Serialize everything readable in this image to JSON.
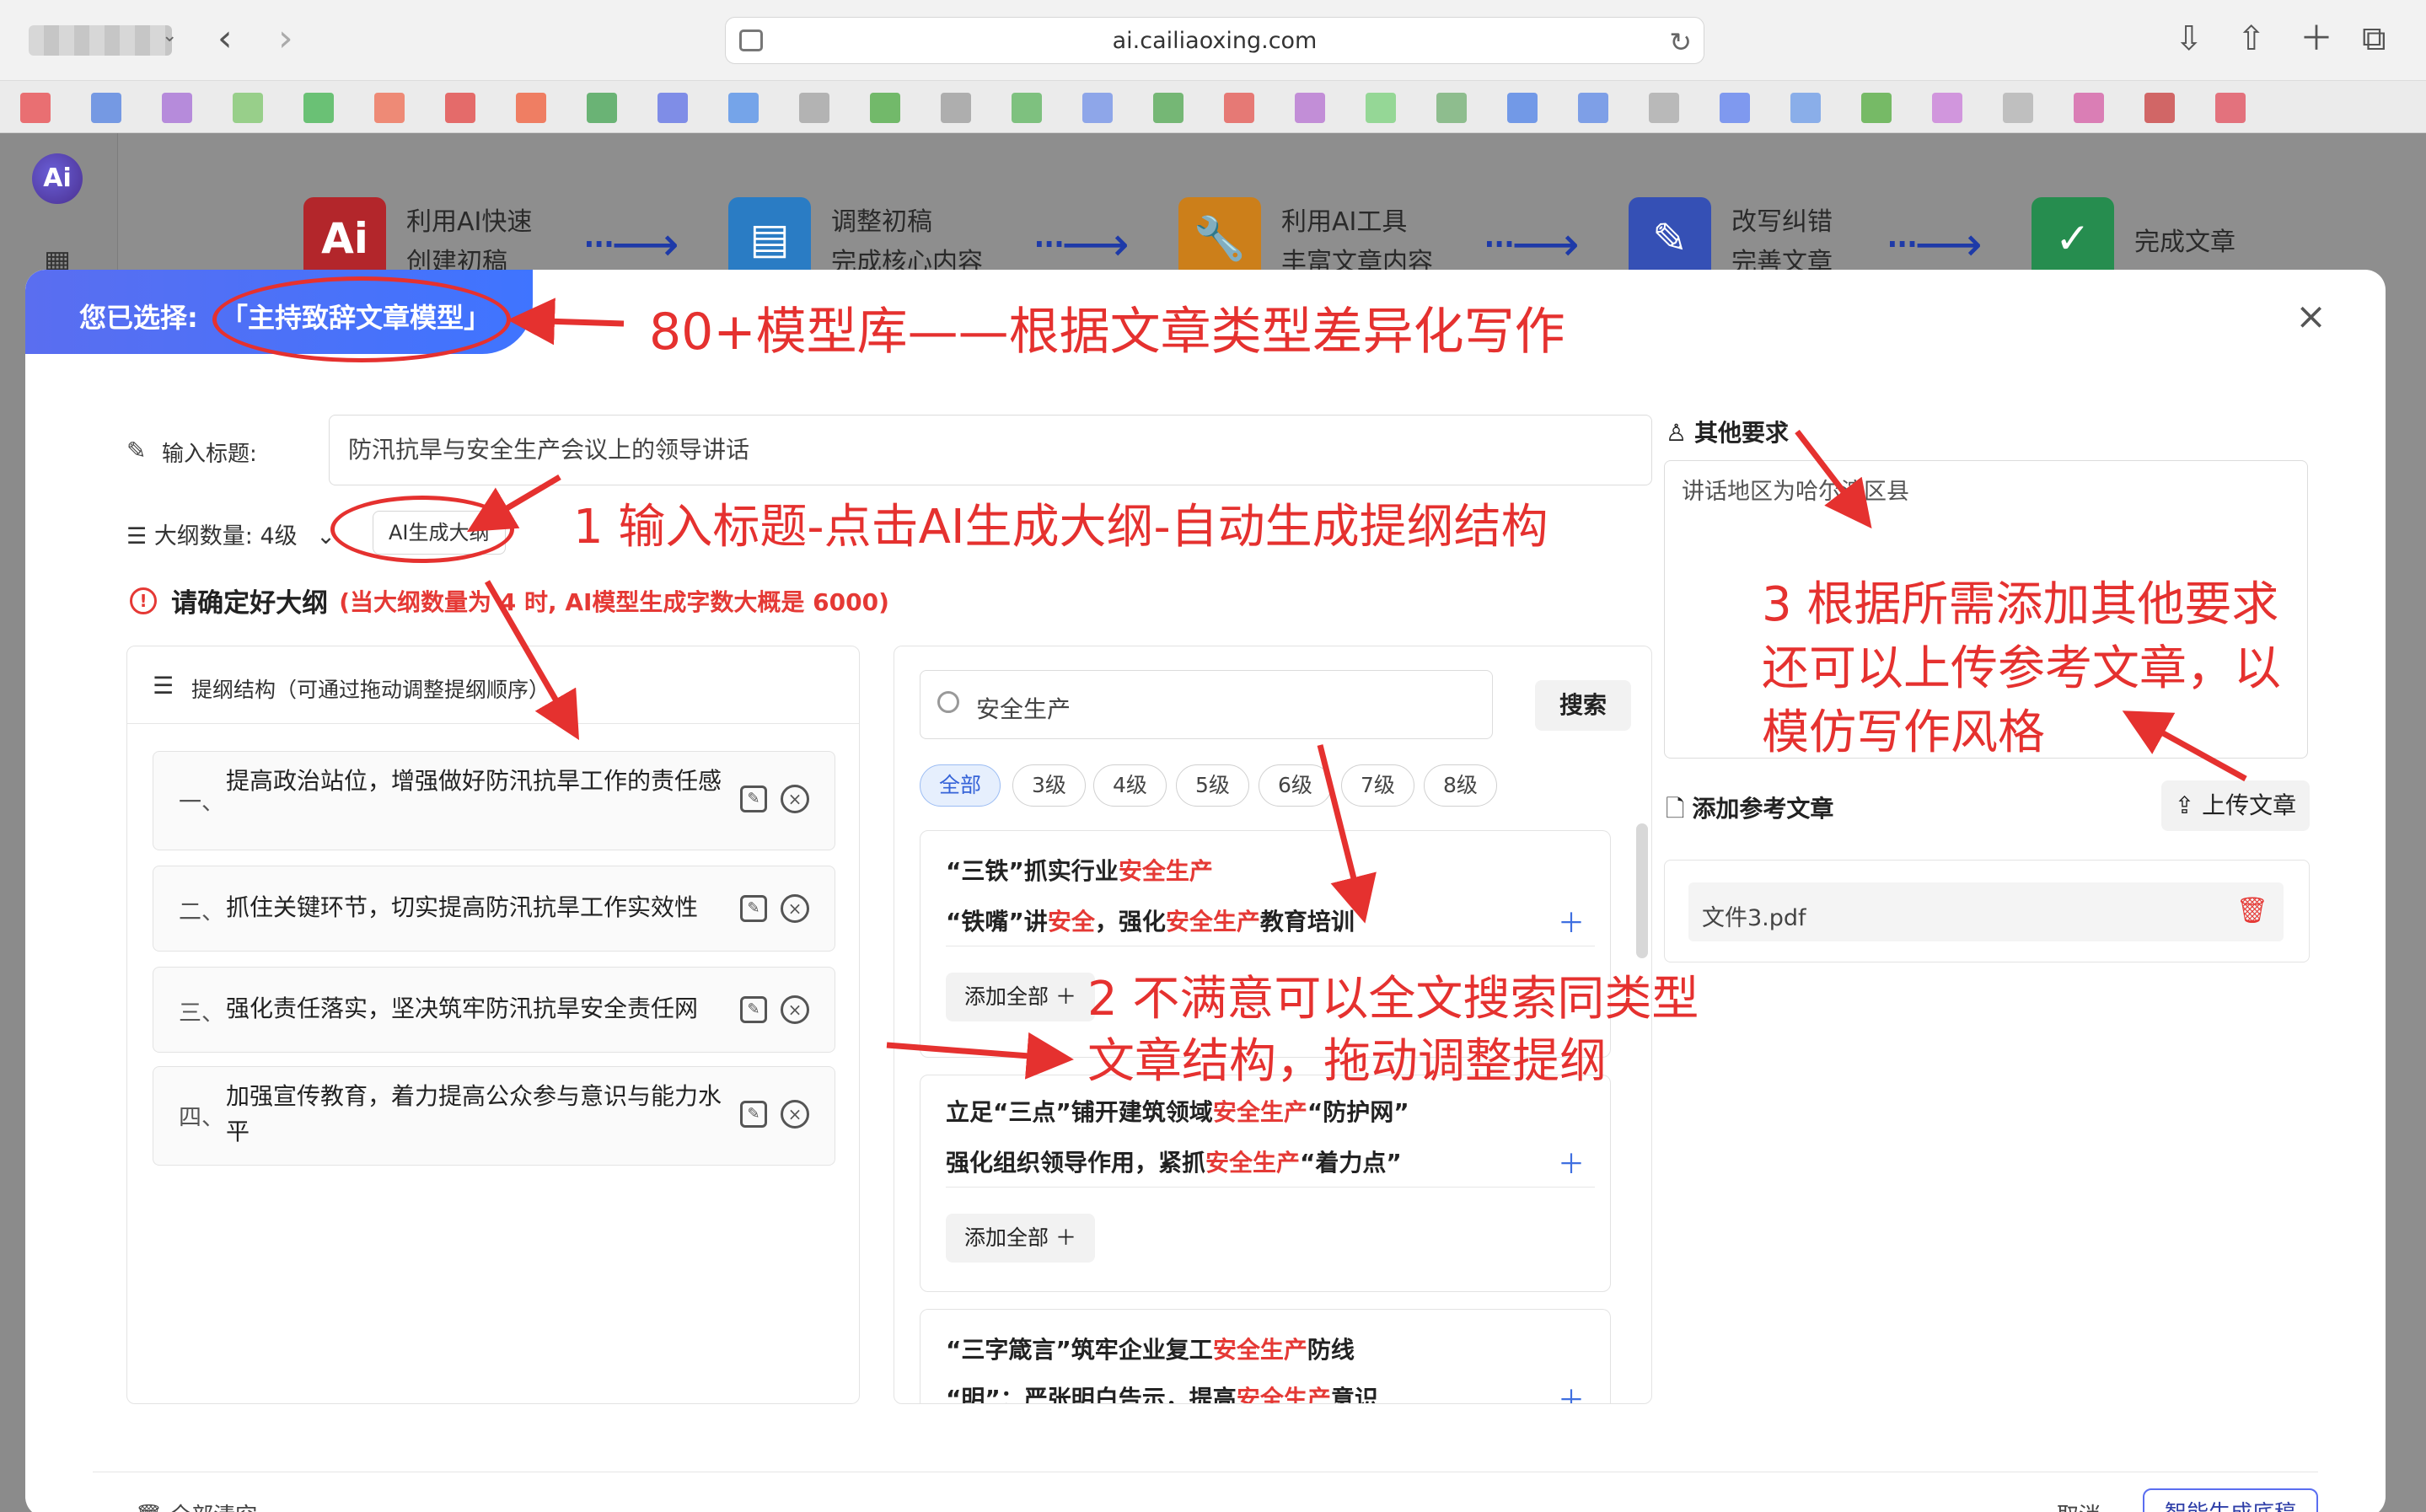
{
  "browser": {
    "url": "ai.cailiaoxing.com",
    "bookmark_colors": [
      "#e8454a",
      "#4e7de0",
      "#a46bd6",
      "#7cc66a",
      "#3fb34d",
      "#ef6a4f",
      "#e2403f",
      "#f05a36",
      "#3fa04d",
      "#5b6de6",
      "#4d8ce8",
      "#a0a0a0",
      "#4aa83f",
      "#9a9a9a",
      "#5ab35b",
      "#6f8fe8",
      "#4ea64d",
      "#e4534d",
      "#b46fd0",
      "#78d07a",
      "#6fae6f",
      "#4a7ee6",
      "#5a86e6",
      "#a8a8a8",
      "#5b7ef0",
      "#6a9ae8",
      "#4faa3a",
      "#c879d8",
      "#b0b0b0",
      "#d45aa3",
      "#c83a3a",
      "#e04a58"
    ]
  },
  "app": {
    "logo_text": "Ai",
    "steps": [
      {
        "icon": "Ai",
        "color": "#c1272d",
        "line1": "利用AI快速",
        "line2": "创建初稿"
      },
      {
        "icon": "▤",
        "color": "#2e88d6",
        "line1": "调整初稿",
        "line2": "完成核心内容"
      },
      {
        "icon": "🔧",
        "color": "#e08b1c",
        "line1": "利用AI工具",
        "line2": "丰富文章内容"
      },
      {
        "icon": "✎",
        "color": "#3b58c6",
        "line1": "改写纠错",
        "line2": "完善文章"
      },
      {
        "icon": "✓",
        "color": "#2a9d58",
        "line1": "完成文章",
        "line2": ""
      }
    ]
  },
  "modal": {
    "selected_label": "您已选择:",
    "selected_model": "「主持致辞文章模型」",
    "close": "×",
    "title_label": "输入标题:",
    "title_value": "防汛抗旱与安全生产会议上的领导讲话",
    "level_label": "大纲数量: 4级",
    "ai_button": "AI生成大纲",
    "confirm_head": "请确定好大纲",
    "confirm_note": "(当大纲数量为 4 时, AI模型生成字数大概是 6000)",
    "outline_header": "提纲结构（可通过拖动调整提纲顺序）",
    "outline": [
      {
        "num": "一、",
        "text": "提高政治站位，增强做好防汛抗旱工作的责任感"
      },
      {
        "num": "二、",
        "text": "抓住关键环节，切实提高防汛抗旱工作实效性"
      },
      {
        "num": "三、",
        "text": "强化责任落实，坚决筑牢防汛抗旱安全责任网"
      },
      {
        "num": "四、",
        "text": "加强宣传教育，着力提高公众参与意识与能力水平"
      }
    ],
    "search_value": "安全生产",
    "search_button": "搜索",
    "chips": [
      "全部",
      "3级",
      "4级",
      "5级",
      "6级",
      "7级",
      "8级"
    ],
    "results": [
      {
        "l1_pre": "“三铁”抓实行业",
        "l1_hl": "安全生产",
        "l1_post": "",
        "l2_pre": "“铁嘴”讲",
        "l2_hl": "安全",
        "l2_mid": "，强化",
        "l2_hl2": "安全生产",
        "l2_post": "教育培训",
        "add_all": "添加全部  ＋"
      },
      {
        "l1_pre": "立足“三点”铺开建筑领域",
        "l1_hl": "安全生产",
        "l1_post": "“防护网”",
        "l2_pre": "强化组织领导作用，紧抓",
        "l2_hl": "安全生产",
        "l2_mid": "“着力点”",
        "l2_hl2": "",
        "l2_post": "",
        "add_all": "添加全部  ＋"
      },
      {
        "l1_pre": "“三字箴言”筑牢企业复工",
        "l1_hl": "安全生产",
        "l1_post": "防线",
        "l2_pre": "“明”：严张明白告示，提高",
        "l2_hl": "安全生产",
        "l2_mid": "意识",
        "l2_hl2": "",
        "l2_post": ""
      }
    ],
    "other_label": "其他要求",
    "other_value": "讲话地区为哈尔滨区县",
    "ref_label": "添加参考文章",
    "upload_button": "上传文章",
    "file_name": "文件3.pdf",
    "clear_all": "全部清空",
    "cancel": "取消",
    "generate": "智能生成底稿"
  },
  "annotations": {
    "a0": "80+模型库——根据文章类型差异化写作",
    "a1": "1 输入标题-点击AI生成大纲-自动生成提纲结构",
    "a2_line1": "2 不满意可以全文搜索同类型",
    "a2_line2": "文章结构，拖动调整提纲",
    "a3_line1": "3 根据所需添加其他要求",
    "a3_line2": "还可以上传参考文章，以",
    "a3_line3": "模仿写作风格"
  }
}
